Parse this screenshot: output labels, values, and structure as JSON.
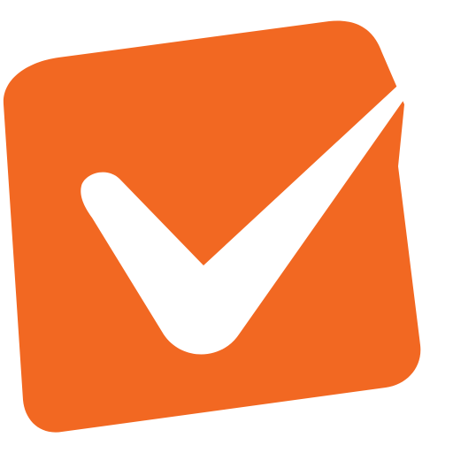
{
  "logo": {
    "icon": "checkbox-check-icon",
    "colors": {
      "box": "#F26822",
      "check": "#FFFFFF",
      "background": "#FFFFFF"
    }
  }
}
